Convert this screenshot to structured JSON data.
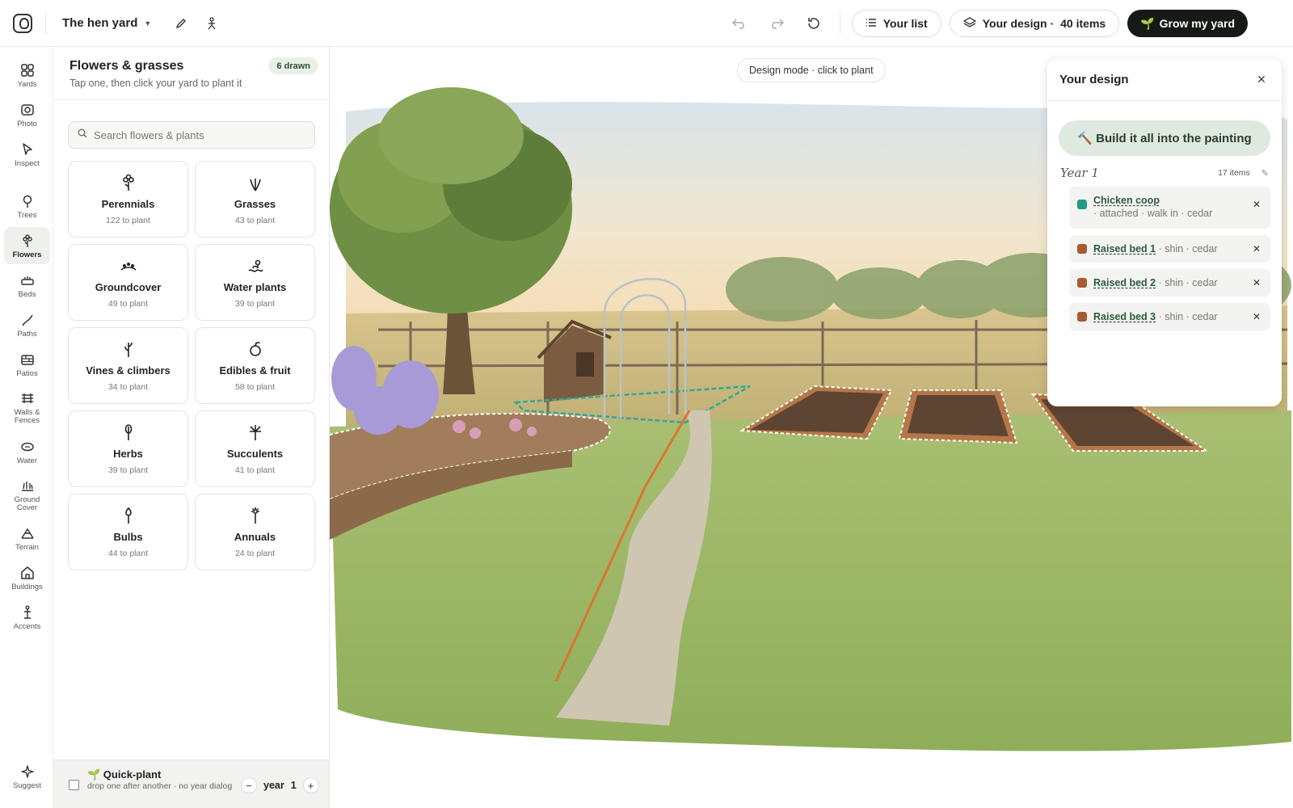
{
  "topbar": {
    "yard_name": "The hen yard",
    "your_list_label": "Your list",
    "your_design_label": "Your design ·",
    "your_design_count": "40 items",
    "grow_label": "Grow my yard"
  },
  "rail": [
    {
      "id": "yards",
      "label": "Yards"
    },
    {
      "id": "photo",
      "label": "Photo"
    },
    {
      "id": "inspect",
      "label": "Inspect"
    },
    {
      "id": "trees",
      "label": "Trees"
    },
    {
      "id": "flowers",
      "label": "Flowers",
      "active": true
    },
    {
      "id": "beds",
      "label": "Beds"
    },
    {
      "id": "paths",
      "label": "Paths"
    },
    {
      "id": "patios",
      "label": "Patios"
    },
    {
      "id": "walls",
      "label": "Walls & Fences"
    },
    {
      "id": "water",
      "label": "Water"
    },
    {
      "id": "ground",
      "label": "Ground Cover"
    },
    {
      "id": "terrain",
      "label": "Terrain"
    },
    {
      "id": "buildings",
      "label": "Buildings"
    },
    {
      "id": "accents",
      "label": "Accents"
    }
  ],
  "suggest_label": "Suggest",
  "panel": {
    "title": "Flowers & grasses",
    "subtitle": "Tap one, then click your yard to plant it",
    "drawn_badge": "6 drawn",
    "search_placeholder": "Search flowers & plants",
    "categories": [
      {
        "name": "Perennials",
        "count": "122 to plant",
        "icon": "perennial-icon"
      },
      {
        "name": "Grasses",
        "count": "43 to plant",
        "icon": "grass-icon"
      },
      {
        "name": "Groundcover",
        "count": "49 to plant",
        "icon": "groundcover-icon"
      },
      {
        "name": "Water plants",
        "count": "39 to plant",
        "icon": "water-plant-icon"
      },
      {
        "name": "Vines & climbers",
        "count": "34 to plant",
        "icon": "vine-icon"
      },
      {
        "name": "Edibles & fruit",
        "count": "58 to plant",
        "icon": "fruit-icon"
      },
      {
        "name": "Herbs",
        "count": "39 to plant",
        "icon": "herb-icon"
      },
      {
        "name": "Succulents",
        "count": "41 to plant",
        "icon": "succulent-icon"
      },
      {
        "name": "Bulbs",
        "count": "44 to plant",
        "icon": "bulb-icon"
      },
      {
        "name": "Annuals",
        "count": "24 to plant",
        "icon": "annual-icon"
      }
    ]
  },
  "quick": {
    "title": "🌱 Quick-plant",
    "subtitle": "drop one after another · no year dialog",
    "year_label": "year",
    "year_value": "1"
  },
  "canvas": {
    "mode_chip": "Design mode · click to plant"
  },
  "design": {
    "title": "Your design",
    "build_label": "🔨 Build it all into the painting",
    "year_label": "Year 1",
    "year_count": "17 items",
    "items": [
      {
        "name": "Chicken coop",
        "detail": "· attached · walk in · cedar",
        "color": "#1f9a86"
      },
      {
        "name": "Raised bed 1",
        "detail": "· shin · cedar",
        "color": "#a85a2e"
      },
      {
        "name": "Raised bed 2",
        "detail": "· shin · cedar",
        "color": "#a85a2e"
      },
      {
        "name": "Raised bed 3",
        "detail": "· shin · cedar",
        "color": "#a85a2e"
      }
    ]
  },
  "colors": {
    "accent_dark": "#161a17",
    "badge_green": "#2f4d37",
    "path_orange": "#d9762f",
    "teal_outline": "#2fa89a"
  }
}
